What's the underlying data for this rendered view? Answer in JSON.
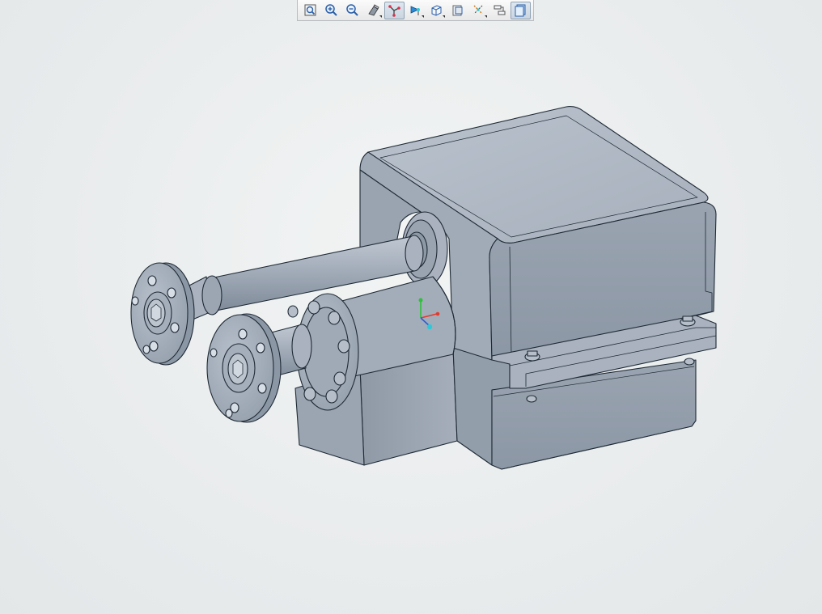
{
  "app": {
    "title": ""
  },
  "toolbar": {
    "buttons": [
      {
        "name": "zoom-fit-button",
        "icon": "zoom-fit-icon",
        "active": false,
        "flyout": false
      },
      {
        "name": "zoom-in-button",
        "icon": "zoom-in-icon",
        "active": false,
        "flyout": false
      },
      {
        "name": "zoom-out-button",
        "icon": "zoom-out-icon",
        "active": false,
        "flyout": false
      },
      {
        "name": "display-style-button",
        "icon": "display-style-icon",
        "active": false,
        "flyout": true
      },
      {
        "name": "datum-display-button",
        "icon": "datum-axes-icon",
        "active": true,
        "flyout": false
      },
      {
        "name": "spin-center-button",
        "icon": "spin-center-icon",
        "active": false,
        "flyout": true
      },
      {
        "name": "view-orientation-button",
        "icon": "cube-view-icon",
        "active": false,
        "flyout": true
      },
      {
        "name": "saved-views-button",
        "icon": "saved-views-icon",
        "active": false,
        "flyout": false
      },
      {
        "name": "annotation-display-button",
        "icon": "annotation-icon",
        "active": false,
        "flyout": true
      },
      {
        "name": "section-view-button",
        "icon": "section-view-icon",
        "active": false,
        "flyout": false
      },
      {
        "name": "appearance-button",
        "icon": "appearance-icon",
        "active": true,
        "flyout": false
      }
    ]
  },
  "colors": {
    "background": "#e9eced",
    "model_face": "#a4adb9",
    "model_top": "#b3bcc8",
    "model_shadow": "#7f8a98",
    "edge": "#1f2a36",
    "axis_x": "#e23a2e",
    "axis_y": "#2fbf3b",
    "axis_z": "#2a5bd8",
    "spin_center": "#2ec9d6"
  }
}
